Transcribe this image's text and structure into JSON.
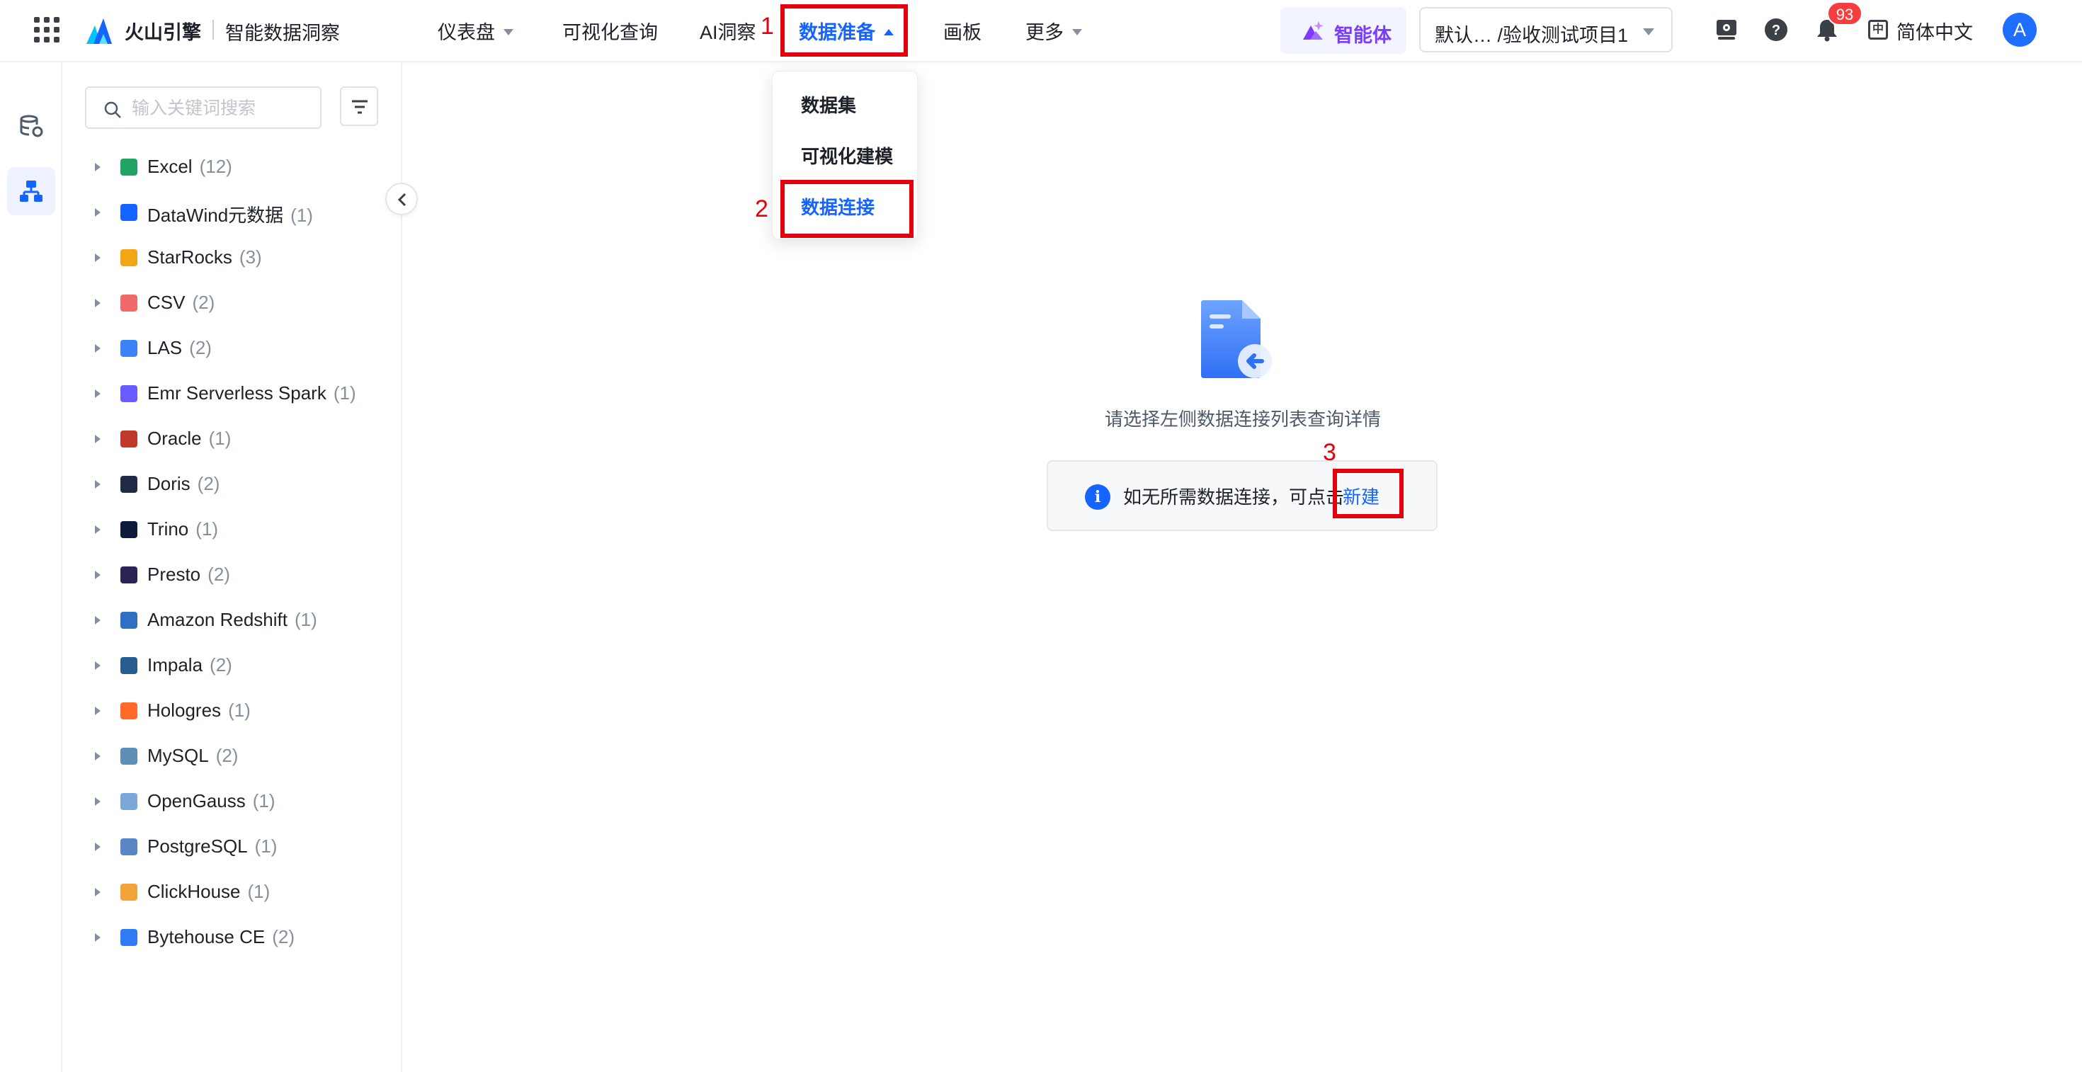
{
  "brand": {
    "name": "火山引擎",
    "product": "智能数据洞察"
  },
  "nav": {
    "items": [
      {
        "label": "仪表盘",
        "has_caret": true
      },
      {
        "label": "可视化查询",
        "has_caret": false
      },
      {
        "label": "AI洞察",
        "has_caret": false
      },
      {
        "label": "数据准备",
        "has_caret": true,
        "active": true
      },
      {
        "label": "画板",
        "has_caret": false
      },
      {
        "label": "更多",
        "has_caret": true
      }
    ]
  },
  "agent_button": {
    "label": "智能体"
  },
  "project_select": {
    "value": "默认… /验收测试项目1"
  },
  "notifications": {
    "count": "93"
  },
  "language": {
    "icon_text": "中",
    "label": "简体中文"
  },
  "user": {
    "avatar_letter": "A"
  },
  "annotations": [
    "1",
    "2",
    "3"
  ],
  "dropdown": {
    "items": [
      {
        "label": "数据集"
      },
      {
        "label": "可视化建模"
      },
      {
        "label": "数据连接",
        "active": true
      }
    ]
  },
  "search": {
    "placeholder": "输入关键词搜索",
    "value": ""
  },
  "tree": {
    "items": [
      {
        "name": "Excel",
        "count": "(12)",
        "icon": "excel-icon",
        "color": "#21a366"
      },
      {
        "name": "DataWind元数据",
        "count": "(1)",
        "icon": "datawind-icon",
        "color": "#1664ff"
      },
      {
        "name": "StarRocks",
        "count": "(3)",
        "icon": "starrocks-icon",
        "color": "#f2a516"
      },
      {
        "name": "CSV",
        "count": "(2)",
        "icon": "csv-icon",
        "color": "#f06a6a"
      },
      {
        "name": "LAS",
        "count": "(2)",
        "icon": "las-icon",
        "color": "#3b82f6"
      },
      {
        "name": "Emr Serverless Spark",
        "count": "(1)",
        "icon": "emr-icon",
        "color": "#6b5cff"
      },
      {
        "name": "Oracle",
        "count": "(1)",
        "icon": "oracle-icon",
        "color": "#c0392b"
      },
      {
        "name": "Doris",
        "count": "(2)",
        "icon": "doris-icon",
        "color": "#1f2a44"
      },
      {
        "name": "Trino",
        "count": "(1)",
        "icon": "trino-icon",
        "color": "#0d1a3a"
      },
      {
        "name": "Presto",
        "count": "(2)",
        "icon": "presto-icon",
        "color": "#2a2452"
      },
      {
        "name": "Amazon Redshift",
        "count": "(1)",
        "icon": "redshift-icon",
        "color": "#2f6fc4"
      },
      {
        "name": "Impala",
        "count": "(2)",
        "icon": "impala-icon",
        "color": "#2a5d8f"
      },
      {
        "name": "Hologres",
        "count": "(1)",
        "icon": "hologres-icon",
        "color": "#ff6a2b"
      },
      {
        "name": "MySQL",
        "count": "(2)",
        "icon": "mysql-icon",
        "color": "#5f8fb6"
      },
      {
        "name": "OpenGauss",
        "count": "(1)",
        "icon": "opengauss-icon",
        "color": "#7da7d9"
      },
      {
        "name": "PostgreSQL",
        "count": "(1)",
        "icon": "postgresql-icon",
        "color": "#5b86c5"
      },
      {
        "name": "ClickHouse",
        "count": "(1)",
        "icon": "clickhouse-icon",
        "color": "#f3a33a"
      },
      {
        "name": "Bytehouse CE",
        "count": "(2)",
        "icon": "bytehouse-icon",
        "color": "#2f7cf6"
      }
    ]
  },
  "main": {
    "empty_text": "请选择左侧数据连接列表查询详情",
    "info_text": "如无所需数据连接，可点击",
    "info_link": "新建"
  },
  "colors": {
    "accent": "#1664ff",
    "annotation": "#e5000e",
    "agent": "#7b3cff",
    "badge": "#f53f3f"
  }
}
